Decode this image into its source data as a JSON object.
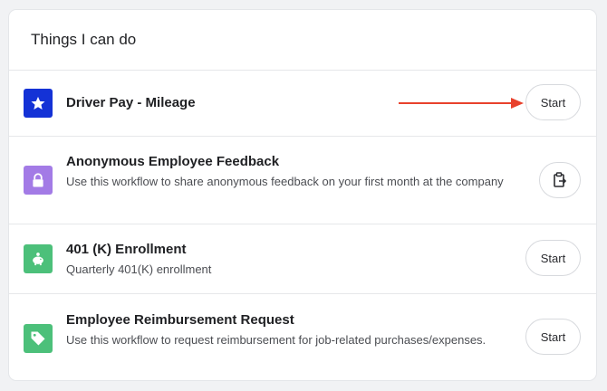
{
  "card": {
    "title": "Things I can do"
  },
  "items": [
    {
      "icon": "star-icon",
      "title": "Driver Pay - Mileage",
      "description": "",
      "action": "Start",
      "accent": "#1432d6"
    },
    {
      "icon": "lock-icon",
      "title": "Anonymous Employee Feedback",
      "description": "Use this workflow to share anonymous feedback on your first month at the company",
      "action_icon": "clipboard-icon",
      "accent": "#a37be6"
    },
    {
      "icon": "piggy-bank-icon",
      "title": "401 (K) Enrollment",
      "description": "Quarterly 401(K) enrollment",
      "action": "Start",
      "accent": "#4cc07a"
    },
    {
      "icon": "tag-icon",
      "title": "Employee Reimbursement Request",
      "description": "Use this workflow to request reimbursement for job-related purchases/expenses.",
      "action": "Start",
      "accent": "#4cc07a"
    }
  ],
  "annotation": {
    "arrow_color": "#e8412c"
  }
}
